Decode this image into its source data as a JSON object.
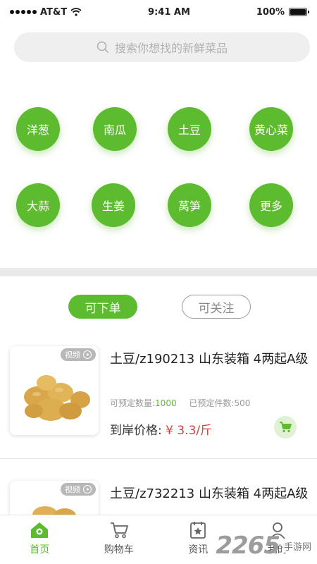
{
  "status_bar": {
    "carrier": "AT&T",
    "time": "9:41 AM",
    "battery": "100%"
  },
  "search": {
    "placeholder": "搜索你想找的新鲜菜品"
  },
  "categories": [
    "洋葱",
    "南瓜",
    "土豆",
    "黄心菜",
    "大蒜",
    "生姜",
    "莴笋",
    "更多"
  ],
  "tabs": {
    "active": "可下单",
    "inactive": "可关注"
  },
  "products": [
    {
      "badge": "视频",
      "title": "土豆/z190213 山东装箱 4两起A级",
      "orderable_label": "可预定数量:",
      "orderable_value": "1000",
      "ordered_label": "已预定件数:",
      "ordered_value": "500",
      "price_label": "到岸价格:",
      "price": "¥ 3.3/斤"
    },
    {
      "badge": "视频",
      "title": "土豆/z732213 山东装箱 4两起A级"
    }
  ],
  "tabbar": {
    "home": "首页",
    "cart": "购物车",
    "news": "资讯",
    "mine": "我的"
  },
  "watermark": {
    "number": "2265",
    "text": "手游网"
  },
  "colors": {
    "brand_green": "#5cbb2e",
    "price_red": "#e0393a"
  }
}
